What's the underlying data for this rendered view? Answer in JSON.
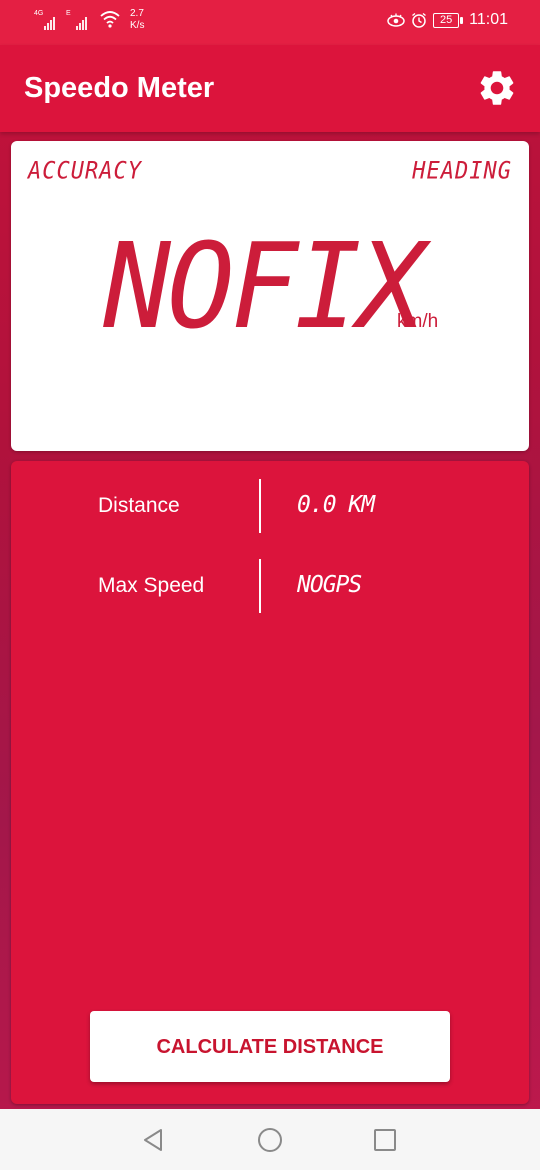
{
  "status_bar": {
    "signal1_tag": "4G",
    "signal2_tag": "E",
    "net_speed_value": "2.7",
    "net_speed_unit": "K/s",
    "battery": "25",
    "time": "11:01"
  },
  "app_bar": {
    "title": "Speedo Meter",
    "settings_icon": "gear-icon"
  },
  "speed_card": {
    "accuracy_label": "ACCURACY",
    "heading_label": "HEADING",
    "speed_value": "NOFIX",
    "speed_unit": "km/h"
  },
  "info": {
    "rows": [
      {
        "label": "Distance",
        "value": "0.0 KM"
      },
      {
        "label": "Max Speed",
        "value": "NOGPS"
      }
    ],
    "calculate_button": "CALCULATE DISTANCE"
  },
  "nav": {
    "icons": [
      "back-icon",
      "home-icon",
      "recents-icon"
    ]
  },
  "colors": {
    "primary": "#dc143c",
    "status_bar": "#e41f43",
    "lcd_text": "#cc1d3a"
  }
}
